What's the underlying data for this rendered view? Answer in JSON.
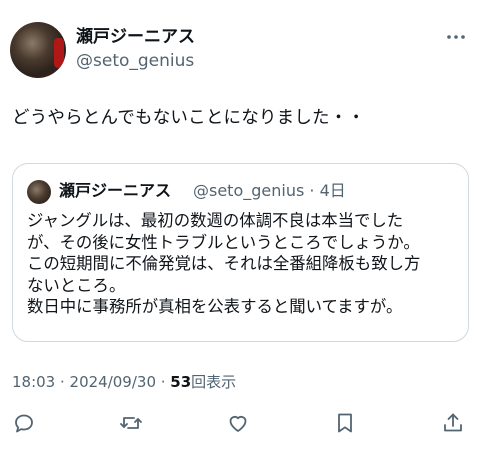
{
  "author": {
    "display_name": "瀬戸ジーニアス",
    "handle": "@seto_genius"
  },
  "tweet": {
    "text": "どうやらとんでもないことになりました・・"
  },
  "quote": {
    "display_name": "瀬戸ジーニアス",
    "handle_time": "@seto_genius · 4日",
    "lines": [
      "ジャングルは、最初の数週の体調不良は本当でした",
      "が、その後に女性トラブルというところでしょうか。",
      "この短期間に不倫発覚は、それは全番組降板も致し方",
      "ないところ。",
      "数日中に事務所が真相を公表すると聞いてますが。"
    ]
  },
  "meta": {
    "timestamp": "18:03 · 2024/09/30 · ",
    "view_count": "53",
    "view_label": "回表示"
  },
  "icons": {
    "more": "more-icon",
    "reply": "reply-icon",
    "retweet": "retweet-icon",
    "like": "like-icon",
    "bookmark": "bookmark-icon",
    "share": "share-icon"
  },
  "colors": {
    "text": "#0f1419",
    "secondary": "#536471",
    "border": "#cfd9de"
  }
}
